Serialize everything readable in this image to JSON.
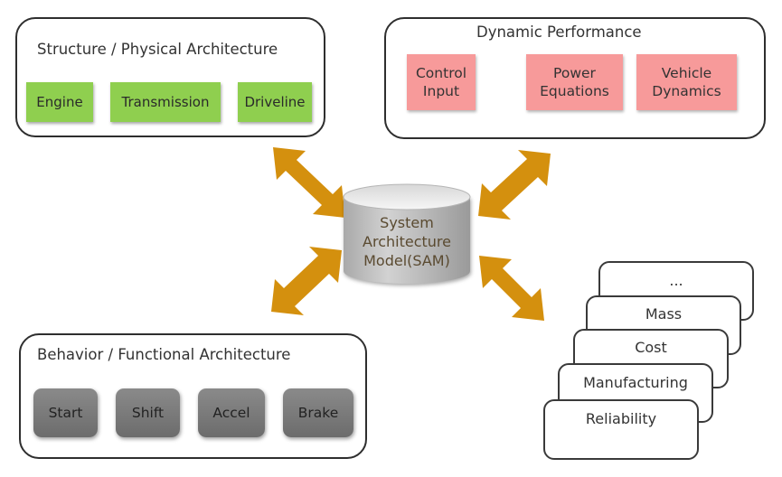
{
  "structure": {
    "title": "Structure / Physical Architecture",
    "blocks": [
      "Engine",
      "Transmission",
      "Driveline"
    ],
    "block_color": "#8fcf4f"
  },
  "dynamic": {
    "title": "Dynamic Performance",
    "blocks": [
      {
        "line1": "Control",
        "line2": "Input"
      },
      {
        "line1": "Power",
        "line2": "Equations"
      },
      {
        "line1": "Vehicle",
        "line2": "Dynamics"
      }
    ],
    "block_color": "#f79a9a"
  },
  "center": {
    "line1": "System",
    "line2": "Architecture",
    "line3": "Model(SAM)"
  },
  "behavior": {
    "title": "Behavior / Functional Architecture",
    "blocks": [
      "Start",
      "Shift",
      "Accel",
      "Brake"
    ]
  },
  "attributes": {
    "cards": [
      "...",
      "Mass",
      "Cost",
      "Manufacturing",
      "Reliability"
    ]
  },
  "arrow_color": "#d4900e"
}
